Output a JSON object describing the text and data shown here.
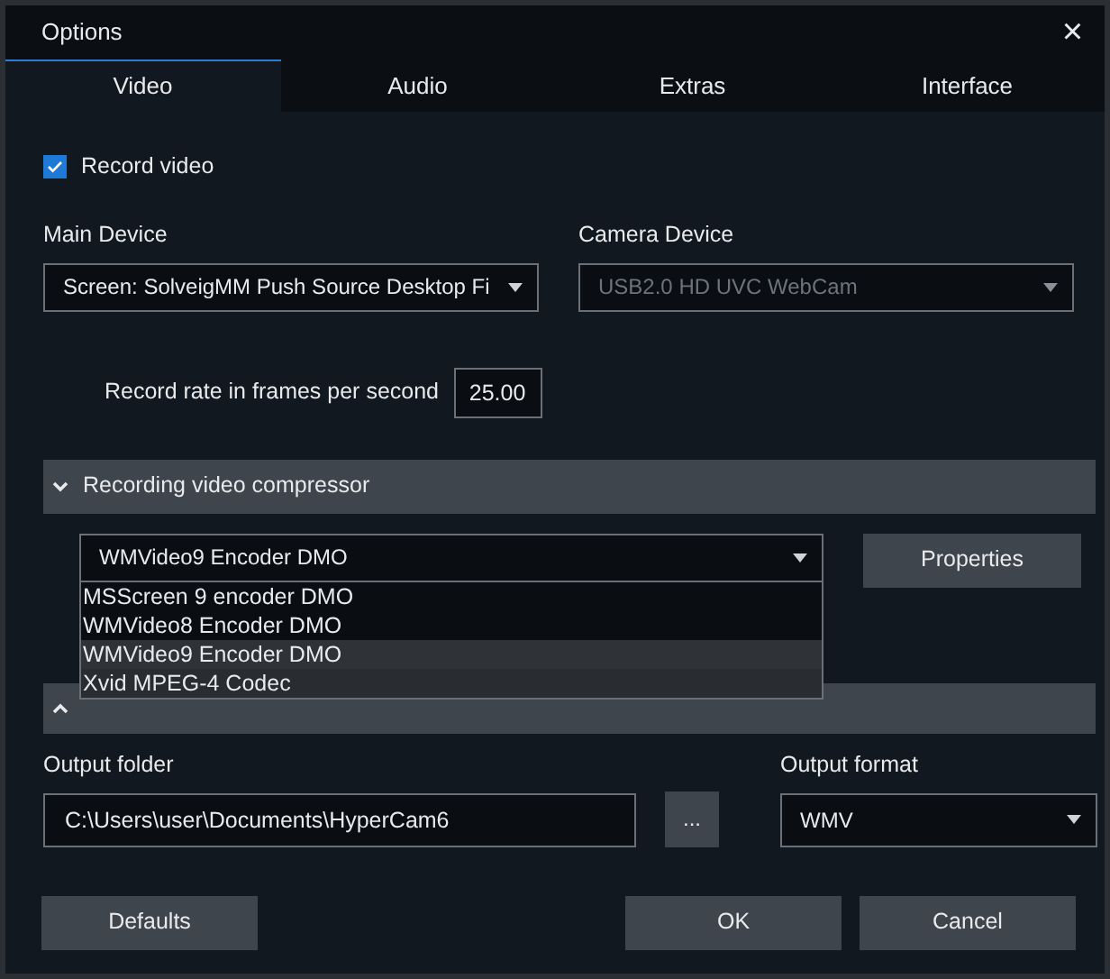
{
  "window": {
    "title": "Options",
    "close": "×"
  },
  "tabs": [
    {
      "label": "Video",
      "selected": true
    },
    {
      "label": "Audio",
      "selected": false
    },
    {
      "label": "Extras",
      "selected": false
    },
    {
      "label": "Interface",
      "selected": false
    }
  ],
  "record_video": {
    "label": "Record video",
    "checked": true
  },
  "main_device": {
    "label": "Main Device",
    "value": "Screen: SolveigMM Push Source Desktop Fi",
    "disabled": false
  },
  "camera_device": {
    "label": "Camera Device",
    "value": "USB2.0 HD UVC WebCam",
    "disabled": true
  },
  "record_rate": {
    "label": "Record rate in frames per second",
    "value": "25.00"
  },
  "recording_compressor": {
    "title": "Recording video compressor",
    "expanded": true,
    "value": "WMVideo9 Encoder DMO",
    "properties": "Properties",
    "options": [
      {
        "label": "MSScreen 9 encoder DMO",
        "selected": false
      },
      {
        "label": "WMVideo8 Encoder DMO",
        "selected": false
      },
      {
        "label": "WMVideo9 Encoder DMO",
        "selected": true
      },
      {
        "label": "Xvid MPEG-4 Codec",
        "selected": false,
        "highlighted": true
      }
    ]
  },
  "streaming_compressor": {
    "expanded": false
  },
  "output_folder": {
    "label": "Output folder",
    "value": "C:\\Users\\user\\Documents\\HyperCam6",
    "browse": "..."
  },
  "output_format": {
    "label": "Output format",
    "value": "WMV"
  },
  "buttons": {
    "defaults": "Defaults",
    "ok": "OK",
    "cancel": "Cancel"
  }
}
